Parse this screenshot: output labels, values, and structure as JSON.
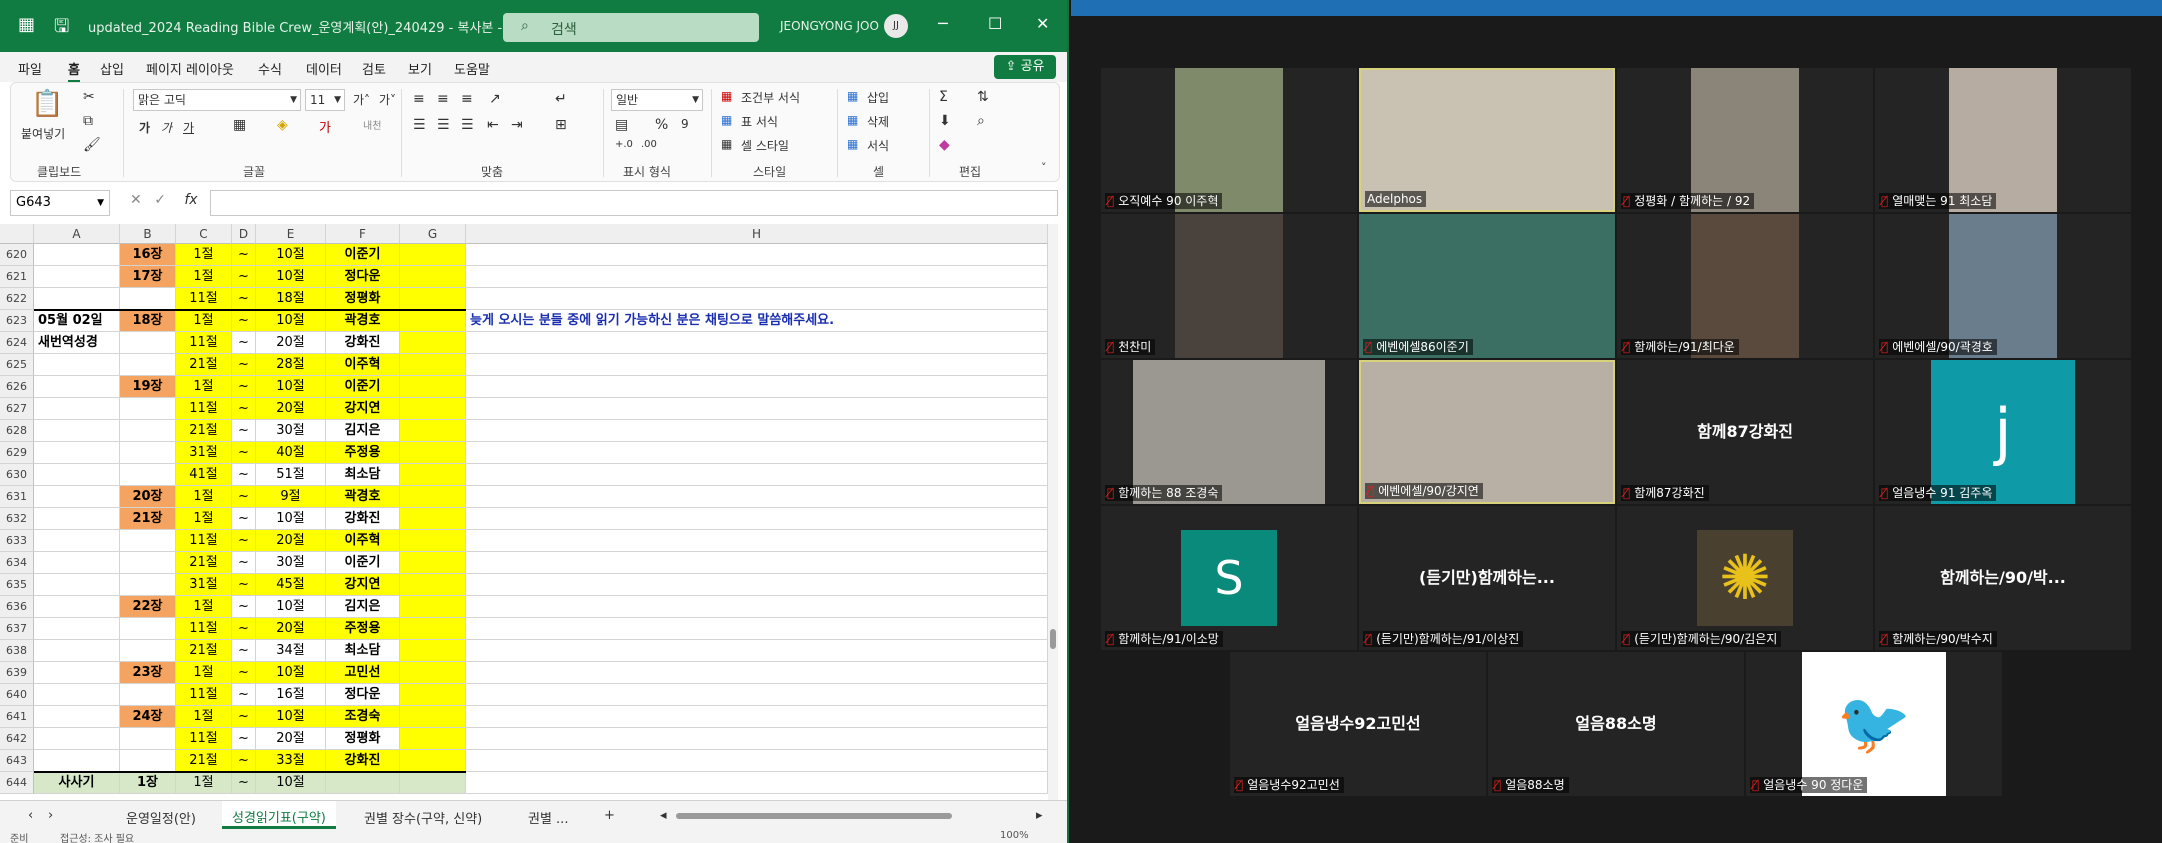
{
  "excel": {
    "doc_title": "updated_2024 Reading Bible Crew_운영계획(안)_240429 - 복사본 - Ex...",
    "search_placeholder": "검색",
    "user_name": "JEONGYONG JOO",
    "user_initials": "JJ",
    "menu": [
      "파일",
      "홈",
      "삽입",
      "페이지 레이아웃",
      "수식",
      "데이터",
      "검토",
      "보기",
      "도움말"
    ],
    "share_label": "공유",
    "ribbon": {
      "paste_label": "붙여넣기",
      "font_name": "맑은 고딕",
      "font_size": "11",
      "number_format": "일반",
      "groups": [
        "클립보드",
        "글꼴",
        "맞춤",
        "표시 형식",
        "스타일",
        "셀",
        "편집"
      ],
      "styles": [
        "조건부 서식",
        "표 서식",
        "셀 스타일"
      ],
      "cells": [
        "삽입",
        "삭제",
        "서식"
      ]
    },
    "name_box": "G643",
    "columns": [
      "A",
      "B",
      "C",
      "D",
      "E",
      "F",
      "G",
      "H"
    ],
    "rows": [
      {
        "num": "620",
        "a": "",
        "b": "16장",
        "c": "1절",
        "d": "~",
        "e": "10절",
        "f": "이준기"
      },
      {
        "num": "621",
        "a": "",
        "b": "17장",
        "c": "1절",
        "d": "~",
        "e": "10절",
        "f": "정다운"
      },
      {
        "num": "622",
        "a": "",
        "b": "",
        "c": "11절",
        "d": "~",
        "e": "18절",
        "f": "정평화"
      },
      {
        "num": "623",
        "a": "05월 02일",
        "b": "18장",
        "c": "1절",
        "d": "~",
        "e": "10절",
        "f": "곽경호"
      },
      {
        "num": "624",
        "a": "새번역성경",
        "b": "",
        "c": "11절",
        "d": "~",
        "e": "20절",
        "f": "강화진"
      },
      {
        "num": "625",
        "a": "",
        "b": "",
        "c": "21절",
        "d": "~",
        "e": "28절",
        "f": "이주혁"
      },
      {
        "num": "626",
        "a": "",
        "b": "19장",
        "c": "1절",
        "d": "~",
        "e": "10절",
        "f": "이준기"
      },
      {
        "num": "627",
        "a": "",
        "b": "",
        "c": "11절",
        "d": "~",
        "e": "20절",
        "f": "강지연"
      },
      {
        "num": "628",
        "a": "",
        "b": "",
        "c": "21절",
        "d": "~",
        "e": "30절",
        "f": "김지은"
      },
      {
        "num": "629",
        "a": "",
        "b": "",
        "c": "31절",
        "d": "~",
        "e": "40절",
        "f": "주정용"
      },
      {
        "num": "630",
        "a": "",
        "b": "",
        "c": "41절",
        "d": "~",
        "e": "51절",
        "f": "최소담"
      },
      {
        "num": "631",
        "a": "",
        "b": "20장",
        "c": "1절",
        "d": "~",
        "e": "9절",
        "f": "곽경호"
      },
      {
        "num": "632",
        "a": "",
        "b": "21장",
        "c": "1절",
        "d": "~",
        "e": "10절",
        "f": "강화진"
      },
      {
        "num": "633",
        "a": "",
        "b": "",
        "c": "11절",
        "d": "~",
        "e": "20절",
        "f": "이주혁"
      },
      {
        "num": "634",
        "a": "",
        "b": "",
        "c": "21절",
        "d": "~",
        "e": "30절",
        "f": "이준기"
      },
      {
        "num": "635",
        "a": "",
        "b": "",
        "c": "31절",
        "d": "~",
        "e": "45절",
        "f": "강지연"
      },
      {
        "num": "636",
        "a": "",
        "b": "22장",
        "c": "1절",
        "d": "~",
        "e": "10절",
        "f": "김지은"
      },
      {
        "num": "637",
        "a": "",
        "b": "",
        "c": "11절",
        "d": "~",
        "e": "20절",
        "f": "주정용"
      },
      {
        "num": "638",
        "a": "",
        "b": "",
        "c": "21절",
        "d": "~",
        "e": "34절",
        "f": "최소담"
      },
      {
        "num": "639",
        "a": "",
        "b": "23장",
        "c": "1절",
        "d": "~",
        "e": "10절",
        "f": "고민선"
      },
      {
        "num": "640",
        "a": "",
        "b": "",
        "c": "11절",
        "d": "~",
        "e": "16절",
        "f": "정다운"
      },
      {
        "num": "641",
        "a": "",
        "b": "24장",
        "c": "1절",
        "d": "~",
        "e": "10절",
        "f": "조경숙"
      },
      {
        "num": "642",
        "a": "",
        "b": "",
        "c": "11절",
        "d": "~",
        "e": "20절",
        "f": "정평화"
      },
      {
        "num": "643",
        "a": "",
        "b": "",
        "c": "21절",
        "d": "~",
        "e": "33절",
        "f": "강화진"
      },
      {
        "num": "644",
        "a": "사사기",
        "b": "1장",
        "c": "1절",
        "d": "~",
        "e": "10절",
        "f": ""
      }
    ],
    "note_text": "늦게 오시는 분들 중에 읽기 가능하신 분은 채팅으로 말씀해주세요.",
    "sheet_tabs": [
      "운영일정(안)",
      "성경읽기표(구약)",
      "권별 장수(구약, 신약)",
      "권별 ..."
    ],
    "status_left": "준비",
    "status_mid": "접근성: 조사 필요",
    "zoom_level": "100%"
  },
  "zoom": {
    "tiles": [
      {
        "label": "오직예수 90 이주혁",
        "kind": "photo",
        "color": "#7e8a6a"
      },
      {
        "label": "Adelphos",
        "kind": "photo",
        "color": "#c9c2b3"
      },
      {
        "label": "정평화 / 함께하는 / 92",
        "kind": "photo",
        "color": "#8b8479"
      },
      {
        "label": "열매맺는 91 최소담",
        "kind": "photo",
        "color": "#b6aca2"
      },
      {
        "label": "천찬미",
        "kind": "photo",
        "color": "#4a423c"
      },
      {
        "label": "에벤에셀86이준기",
        "kind": "photo",
        "color": "#3b6f63"
      },
      {
        "label": "함께하는/91/최다운",
        "kind": "photo",
        "color": "#5a4a3e"
      },
      {
        "label": "에벤에셀/90/곽경호",
        "kind": "photo",
        "color": "#6a7d8c"
      },
      {
        "label": "함께하는 88 조경숙",
        "kind": "photo",
        "color": "#9a9890"
      },
      {
        "label": "에벤에셀/90/강지연",
        "kind": "photo",
        "color": "#b8b0a4"
      },
      {
        "label": "함께87강화진",
        "kind": "name",
        "display": "함께87강화진"
      },
      {
        "label": "얼음냉수 91 김주옥",
        "kind": "letter",
        "letter": "j",
        "color": "#0e9aa7"
      },
      {
        "label": "함께하는/91/이소망",
        "kind": "letter",
        "letter": "S",
        "color": "#0a8a7a"
      },
      {
        "label": "(듣기만)함께하는/91/이상진",
        "kind": "name",
        "display": "(듣기만)함께하는..."
      },
      {
        "label": "(듣기만)함께하는/90/김은지",
        "kind": "photo",
        "color": "#4a4030"
      },
      {
        "label": "함께하는/90/박수지",
        "kind": "name",
        "display": "함께하는/90/박..."
      },
      {
        "label": "얼음냉수92고민선",
        "kind": "name",
        "display": "얼음냉수92고민선"
      },
      {
        "label": "얼음88소명",
        "kind": "name",
        "display": "얼음88소명"
      },
      {
        "label": "얼음냉수 90 정다운",
        "kind": "photo",
        "color": "#ffffff"
      }
    ],
    "speaking_color": "#d8d27a",
    "mute_icon": "mic-muted-icon"
  }
}
